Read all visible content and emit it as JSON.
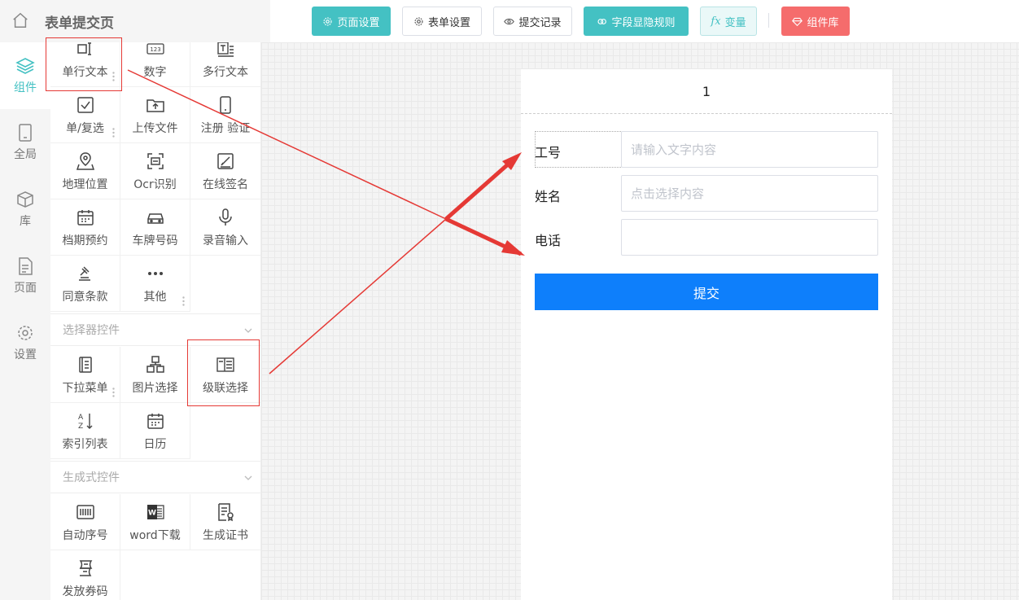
{
  "header": {
    "title": "表单提交页",
    "buttons": {
      "page_settings": "页面设置",
      "form_settings": "表单设置",
      "submit_records": "提交记录",
      "field_rules": "字段显隐规则",
      "variables": "变量",
      "component_lib": "组件库"
    }
  },
  "nav": {
    "components": "组件",
    "global": "全局",
    "library": "库",
    "page": "页面",
    "settings": "设置"
  },
  "components": {
    "single_text": "单行文本",
    "number": "数字",
    "multi_text": "多行文本",
    "checkbox": "单/复选",
    "upload": "上传文件",
    "register_verify": "注册 验证",
    "location": "地理位置",
    "ocr": "Ocr识别",
    "signature": "在线签名",
    "schedule": "档期预约",
    "plate": "车牌号码",
    "voice": "录音输入",
    "agreement": "同意条款",
    "other": "其他",
    "selector_section": "选择器控件",
    "dropdown": "下拉菜单",
    "image_select": "图片选择",
    "cascade": "级联选择",
    "index_list": "索引列表",
    "calendar": "日历",
    "generative_section": "生成式控件",
    "auto_number": "自动序号",
    "word_download": "word下载",
    "certificate": "生成证书",
    "coupon": "发放券码"
  },
  "form": {
    "page_number": "1",
    "fields": [
      {
        "label": "工号",
        "placeholder": "请输入文字内容"
      },
      {
        "label": "姓名",
        "placeholder": "点击选择内容"
      },
      {
        "label": "电话",
        "placeholder": ""
      }
    ],
    "submit": "提交"
  },
  "colors": {
    "accent": "#44c1c3",
    "danger": "#f56c6c",
    "submit": "#0e7ffb",
    "annotation": "#e53935"
  }
}
